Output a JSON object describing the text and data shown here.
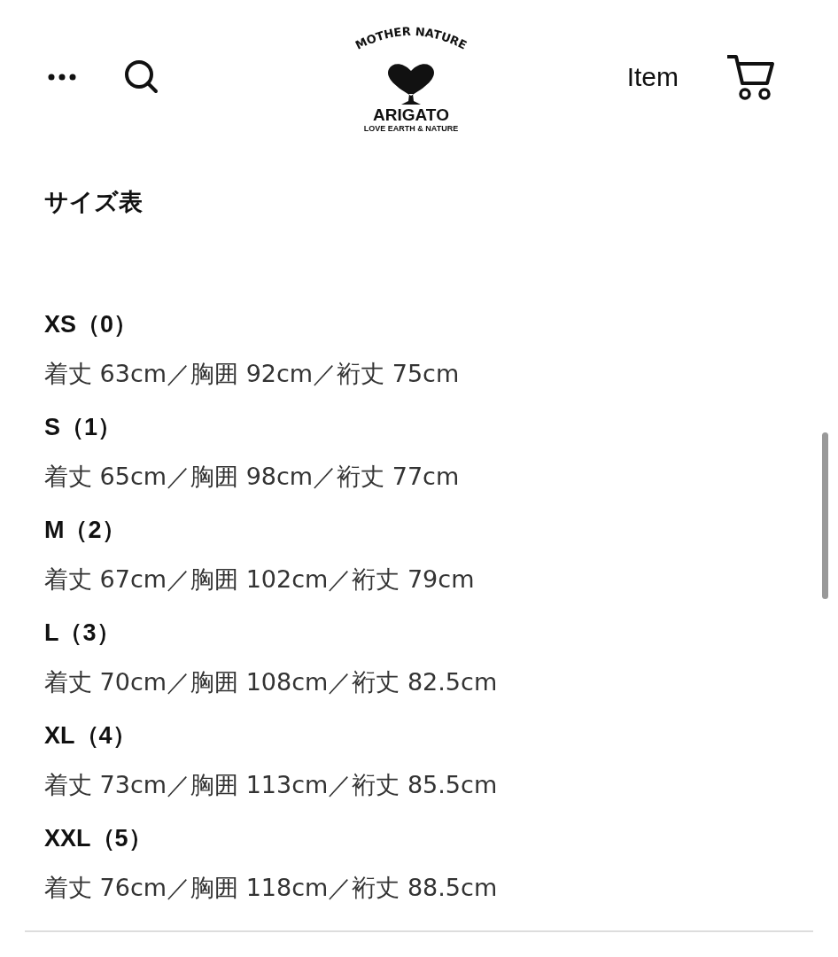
{
  "header": {
    "logo": {
      "arc_text": "MOTHER NATURE",
      "name": "ARIGATO",
      "tagline": "LOVE EARTH & NATURE"
    },
    "item_link": "Item"
  },
  "heading": "サイズ表",
  "sizes": [
    {
      "label": "XS（0）",
      "measurements": "着丈 63cm／胸囲 92cm／裄丈 75cm"
    },
    {
      "label": "S（1）",
      "measurements": "着丈 65cm／胸囲 98cm／裄丈 77cm"
    },
    {
      "label": "M（2）",
      "measurements": "着丈 67cm／胸囲 102cm／裄丈 79cm"
    },
    {
      "label": "L（3）",
      "measurements": "着丈 70cm／胸囲 108cm／裄丈 82.5cm"
    },
    {
      "label": "XL（4）",
      "measurements": "着丈 73cm／胸囲 113cm／裄丈 85.5cm"
    },
    {
      "label": "XXL（5）",
      "measurements": "着丈 76cm／胸囲 118cm／裄丈 88.5cm"
    }
  ]
}
